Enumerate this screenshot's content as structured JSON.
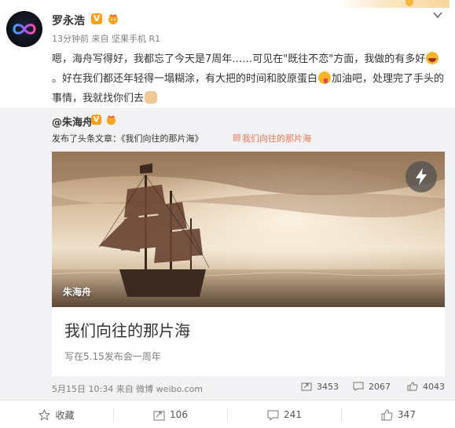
{
  "post": {
    "author": "罗永浩",
    "verified_badge": "V",
    "meta": "13分钟前 来自 坚果手机 R1",
    "text_1": "嗯，海舟写得好，我都忘了今天是7周年……可见在\"既往不恋\"方面，我做的有多好",
    "text_2": "。好在我们都还年轻得一塌糊涂，有大把的时间和胶原蛋白",
    "text_3": "加油吧，处理完了手头的事情，我就找你们去"
  },
  "repost": {
    "author": "@朱海舟",
    "verified_badge": "V",
    "published_prefix": "发布了头条文章：《我们向往的那片海》",
    "link_label": "我们向往的那片海",
    "article": {
      "image_author": "朱海舟",
      "title": "我们向往的那片海",
      "subtitle": "写在5.15发布会一周年"
    },
    "time_source": "5月15日 10:34 来自 微博 weibo.com",
    "stats": {
      "repost": "3453",
      "comment": "2067",
      "like": "4043"
    }
  },
  "actions": {
    "favorite": "收藏",
    "repost": "106",
    "comment": "241",
    "like": "347"
  },
  "colors": {
    "accent": "#eb7350",
    "badge": "#f7a11a",
    "repost_bg": "#f2f2f5"
  },
  "icons": [
    "chevron-down-icon",
    "lightning-icon",
    "link-article-icon",
    "star-icon",
    "repost-icon",
    "comment-icon",
    "like-icon"
  ]
}
